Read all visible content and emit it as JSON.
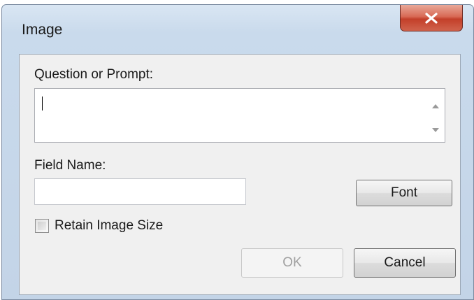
{
  "window": {
    "title": "Image",
    "close_icon": "close-x-icon"
  },
  "form": {
    "prompt_label": "Question or Prompt:",
    "prompt_value": "",
    "field_name_label": "Field Name:",
    "field_name_value": "",
    "retain_label": "Retain Image Size",
    "retain_checked": false
  },
  "buttons": {
    "font": "Font",
    "ok": "OK",
    "cancel": "Cancel"
  },
  "colors": {
    "close_button": "#c3402a",
    "frame": "#c9daec"
  }
}
